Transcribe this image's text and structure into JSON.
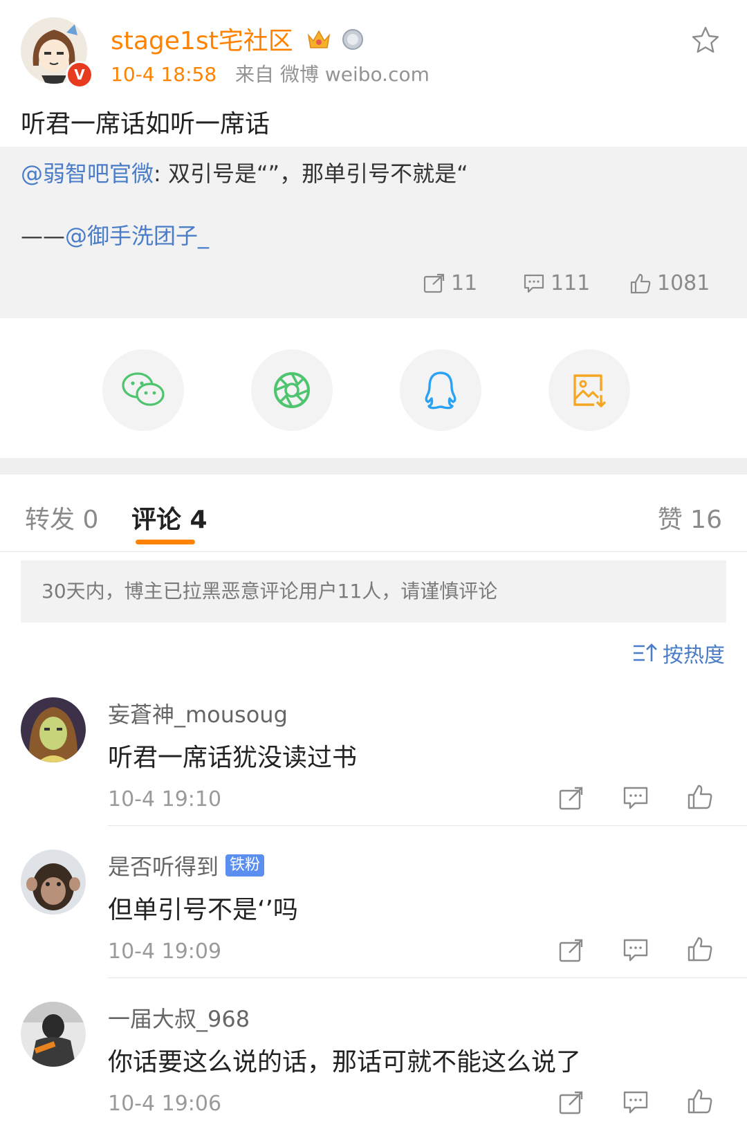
{
  "post": {
    "author": "stage1st宅社区",
    "verified_badge": "V",
    "time": "10-4 18:58",
    "source": "来自 微博 weibo.com",
    "text": "听君一席话如听一席话",
    "quoted": {
      "mention": "@弱智吧官微",
      "text": ": 双引号是“”，那单引号不就是“",
      "credit_prefix": "——",
      "credit_mention": "@御手洗团子_"
    },
    "stats": {
      "reposts": "11",
      "comments": "111",
      "likes": "1081"
    }
  },
  "share": [
    {
      "name": "wechat-icon",
      "color": "#4fc46f"
    },
    {
      "name": "moments-icon",
      "color": "#4fc46f"
    },
    {
      "name": "qq-icon",
      "color": "#2aa2f4"
    },
    {
      "name": "save-image-icon",
      "color": "#f5a623"
    }
  ],
  "tabs": {
    "repost": "转发 0",
    "comment": "评论 4",
    "like": "赞 16"
  },
  "notice": "30天内，博主已拉黑恶意评论用户11人，请谨慎评论",
  "sort_label": "按热度",
  "comments": [
    {
      "user": "妄蒼神_mousoug",
      "badge": "",
      "text": "听君一席话犹没读过书",
      "time": "10-4 19:10"
    },
    {
      "user": "是否听得到",
      "badge": "铁粉",
      "text": "但单引号不是‘’吗",
      "time": "10-4 19:09"
    },
    {
      "user": "一届大叔_968",
      "badge": "",
      "text": "你话要这么说的话，那话可就不能这么说了",
      "time": "10-4 19:06"
    }
  ],
  "colors": {
    "accent": "#ff8200",
    "link": "#4a7cc7",
    "badge": "#5a8ff0"
  }
}
